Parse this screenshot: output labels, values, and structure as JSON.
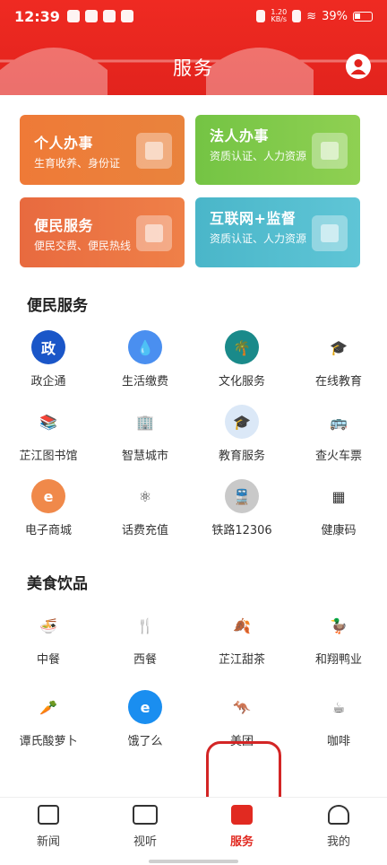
{
  "status_bar": {
    "time": "12:39",
    "speed": "1.20\nKB/s",
    "battery": "39%"
  },
  "header": {
    "title": "服务"
  },
  "cards": [
    {
      "title": "个人办事",
      "subtitle": "生育收养、身份证",
      "color": "#ee7b39"
    },
    {
      "title": "法人办事",
      "subtitle": "资质认证、人力资源",
      "color": "#7fc84a"
    },
    {
      "title": "便民服务",
      "subtitle": "便民交费、便民热线",
      "color": "#ea7343"
    },
    {
      "title": "互联网+监督",
      "subtitle": "资质认证、人力资源",
      "color": "#52bccd"
    }
  ],
  "section_convenience": {
    "title": "便民服务",
    "items": [
      {
        "label": "政企通",
        "icon": "government-icon",
        "glyph": "政",
        "color": "#1a56c8"
      },
      {
        "label": "生活缴费",
        "icon": "water-drop-icon",
        "glyph": "💧",
        "color": "#4a8ff0"
      },
      {
        "label": "文化服务",
        "icon": "palm-icon",
        "glyph": "🌴",
        "color": "#1a8a8a"
      },
      {
        "label": "在线教育",
        "icon": "graduation-cap-icon",
        "glyph": "🎓",
        "color": "#ffffff"
      },
      {
        "label": "芷江图书馆",
        "icon": "books-icon",
        "glyph": "📚",
        "color": "#ffffff"
      },
      {
        "label": "智慧城市",
        "icon": "building-icon",
        "glyph": "🏢",
        "color": "#ffffff"
      },
      {
        "label": "教育服务",
        "icon": "education-icon",
        "glyph": "🎓",
        "color": "#dbe8f7"
      },
      {
        "label": "查火车票",
        "icon": "bus-icon",
        "glyph": "🚌",
        "color": "#ffffff"
      },
      {
        "label": "电子商城",
        "icon": "shop-icon",
        "glyph": "e",
        "color": "#f0894a"
      },
      {
        "label": "话费充值",
        "icon": "atom-icon",
        "glyph": "⚛",
        "color": "#ffffff"
      },
      {
        "label": "铁路12306",
        "icon": "train-icon",
        "glyph": "🚆",
        "color": "#c9c9c9"
      },
      {
        "label": "健康码",
        "icon": "qr-code-icon",
        "glyph": "▦",
        "color": "#ffffff"
      }
    ]
  },
  "section_food": {
    "title": "美食饮品",
    "items": [
      {
        "label": "中餐",
        "icon": "noodle-bowl-icon",
        "glyph": "🍜",
        "color": "#ffffff"
      },
      {
        "label": "西餐",
        "icon": "fork-knife-icon",
        "glyph": "🍴",
        "color": "#ffffff"
      },
      {
        "label": "芷江甜茶",
        "icon": "tea-leaf-icon",
        "glyph": "🍂",
        "color": "#ffffff"
      },
      {
        "label": "和翔鸭业",
        "icon": "duck-icon",
        "glyph": "🦆",
        "color": "#ffffff"
      },
      {
        "label": "谭氏酸萝卜",
        "icon": "carrot-icon",
        "glyph": "🥕",
        "color": "#ffffff"
      },
      {
        "label": "饿了么",
        "icon": "eleme-icon",
        "glyph": "e",
        "color": "#1a8ef0"
      },
      {
        "label": "美团",
        "icon": "meituan-icon",
        "glyph": "🦘",
        "color": "#ffffff"
      },
      {
        "label": "咖啡",
        "icon": "coffee-icon",
        "glyph": "☕",
        "color": "#ffffff"
      }
    ]
  },
  "bottom_nav": {
    "tabs": [
      {
        "label": "新闻"
      },
      {
        "label": "视听"
      },
      {
        "label": "服务"
      },
      {
        "label": "我的"
      }
    ]
  }
}
